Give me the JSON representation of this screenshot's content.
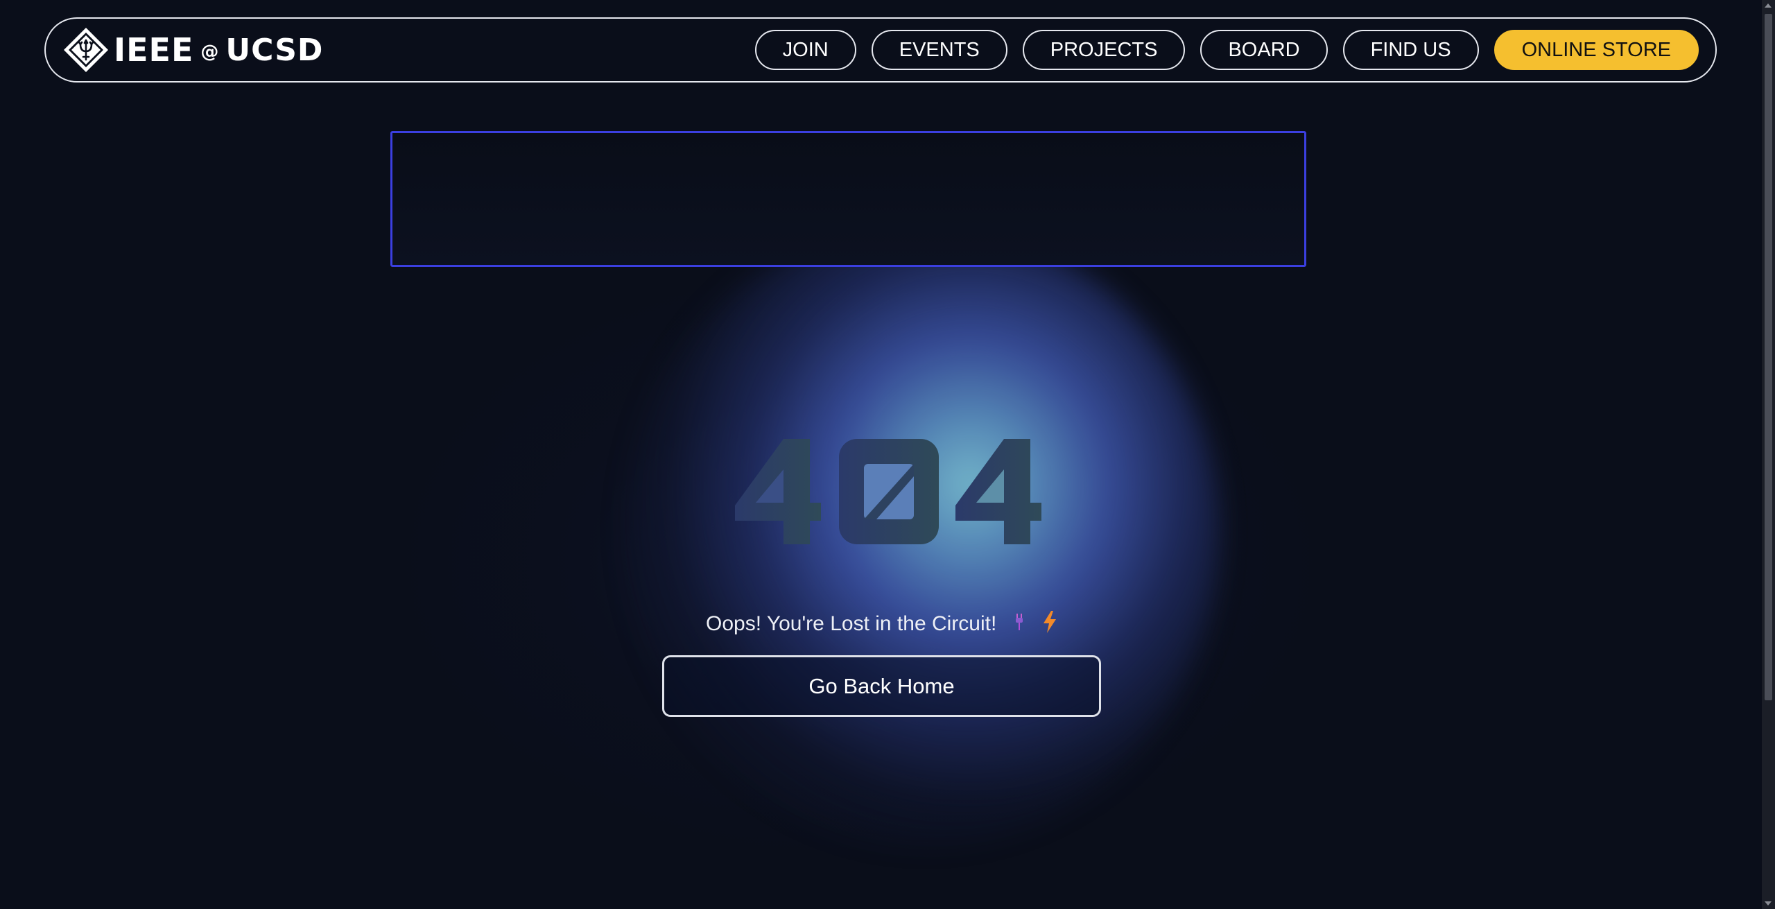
{
  "brand": {
    "ieee": "IEEE",
    "at": "@",
    "ucsd": "UCSD"
  },
  "nav": {
    "items": [
      {
        "label": "JOIN"
      },
      {
        "label": "EVENTS"
      },
      {
        "label": "PROJECTS"
      },
      {
        "label": "BOARD"
      },
      {
        "label": "FIND US"
      }
    ],
    "store_label": "ONLINE STORE"
  },
  "error": {
    "code": "404",
    "message": "Oops! You're Lost in the Circuit!",
    "home_button": "Go Back Home"
  },
  "colors": {
    "background": "#0a0e1a",
    "accent": "#f5bf2f",
    "banner_border": "#3b3fe0"
  }
}
